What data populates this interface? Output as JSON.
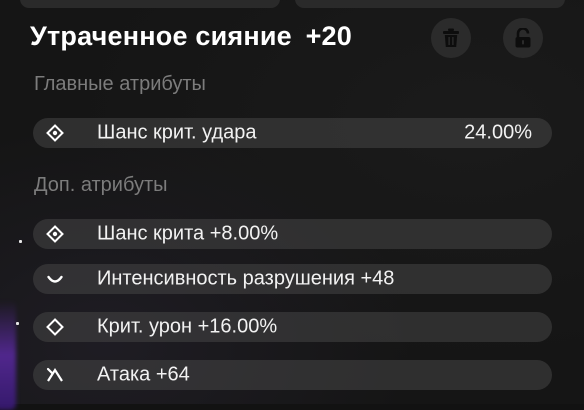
{
  "title": {
    "name": "Утраченное сияние",
    "level": "+20"
  },
  "actions": {
    "delete_icon": "trash-icon",
    "lock_icon": "unlock-icon"
  },
  "main_attributes": {
    "heading": "Главные атрибуты",
    "items": [
      {
        "icon": "crit-chance-icon",
        "name": "Шанс крит. удара",
        "value": "24.00%"
      }
    ]
  },
  "sub_attributes": {
    "heading": "Доп. атрибуты",
    "items": [
      {
        "icon": "crit-chance-icon",
        "name": "Шанс крита +8.00%"
      },
      {
        "icon": "break-intensity-icon",
        "name": "Интенсивность разрушения +48"
      },
      {
        "icon": "crit-damage-icon",
        "name": "Крит. урон +16.00%"
      },
      {
        "icon": "attack-icon",
        "name": "Атака +64"
      }
    ]
  }
}
